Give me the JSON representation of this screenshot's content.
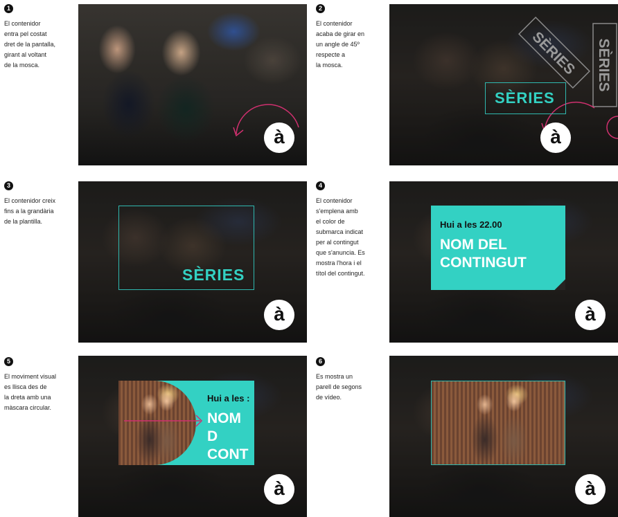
{
  "steps": [
    {
      "num": "1",
      "text": "El contenidor\nentra pel costat\ndret de la pantalla,\ngirant al voltant\nde la mosca."
    },
    {
      "num": "2",
      "text": "El contenidor\nacaba de girar en\nun angle de 45º\nrespecte a\nla mosca."
    },
    {
      "num": "3",
      "text": "El contenidor creix\nfins a la grandària\nde la plantilla."
    },
    {
      "num": "4",
      "text": "El contenidor\ns'emplena amb\nel color de\nsubmarca indicat\nper al contingut\nque s'anuncia. Es\nmostra l'hora i el\ntítol del contingut."
    },
    {
      "num": "5",
      "text": "El moviment visual\nes llisca des de\nla dreta amb una\nmàscara circular."
    },
    {
      "num": "6",
      "text": "Es mostra un\nparell de segons\nde vídeo."
    }
  ],
  "logo_glyph": "à",
  "series_label": "SÈRIES",
  "promo": {
    "time": "Hui a les 22.00",
    "title": "NOM DEL\nCONTINGUT",
    "time_cropped": "Hui a les :",
    "title_cropped": "NOM D\nCONT"
  },
  "colors": {
    "teal": "#33d1c3",
    "magenta": "#d0306f"
  }
}
